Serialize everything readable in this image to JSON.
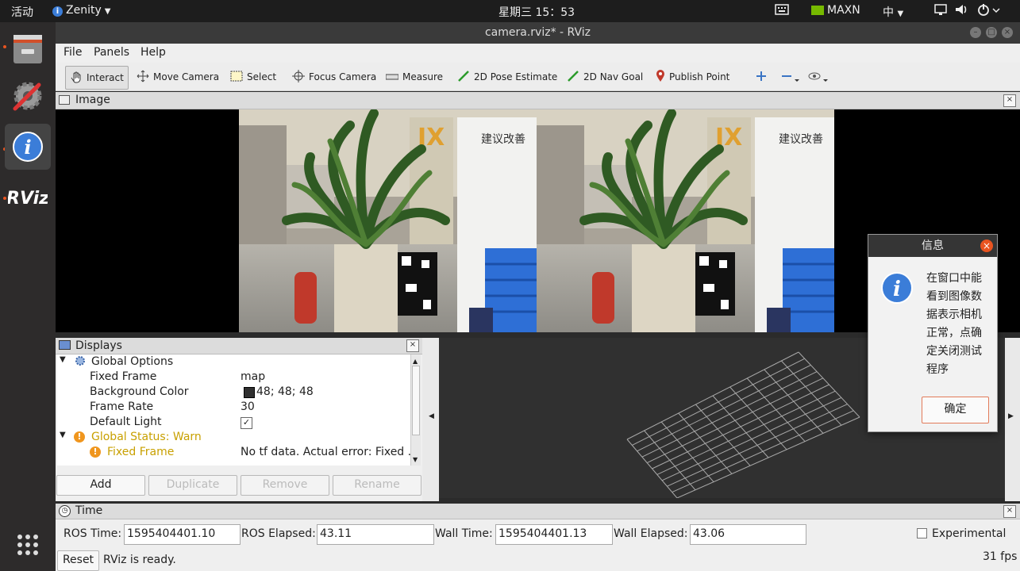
{
  "topbar": {
    "activities": "活动",
    "app_menu": "Zenity",
    "clock": "星期三 15：53",
    "power_mode": "MAXN",
    "input_method": "中"
  },
  "window": {
    "title": "camera.rviz* - RViz"
  },
  "menu": {
    "file": "File",
    "panels": "Panels",
    "help": "Help"
  },
  "toolbar": {
    "interact": "Interact",
    "move_camera": "Move Camera",
    "select": "Select",
    "focus_camera": "Focus Camera",
    "measure": "Measure",
    "pose_estimate": "2D Pose Estimate",
    "nav_goal": "2D Nav Goal",
    "publish_point": "Publish Point"
  },
  "image_panel": {
    "title": "Image",
    "sign_text": "建议改善"
  },
  "displays_panel": {
    "title": "Displays",
    "global_options": "Global Options",
    "fixed_frame_label": "Fixed Frame",
    "fixed_frame_value": "map",
    "background_color_label": "Background Color",
    "background_color_value": "48; 48; 48",
    "background_color_hex": "#303030",
    "frame_rate_label": "Frame Rate",
    "frame_rate_value": "30",
    "default_light_label": "Default Light",
    "global_status": "Global Status: Warn",
    "status_fixed_frame": "Fixed Frame",
    "status_fixed_frame_value": "No tf data.  Actual error: Fixed ...",
    "add": "Add",
    "duplicate": "Duplicate",
    "remove": "Remove",
    "rename": "Rename"
  },
  "time_panel": {
    "title": "Time",
    "ros_time_label": "ROS Time:",
    "ros_time": "1595404401.10",
    "ros_elapsed_label": "ROS Elapsed:",
    "ros_elapsed": "43.11",
    "wall_time_label": "Wall Time:",
    "wall_time": "1595404401.13",
    "wall_elapsed_label": "Wall Elapsed:",
    "wall_elapsed": "43.06",
    "experimental": "Experimental"
  },
  "status": {
    "reset": "Reset",
    "message": "RViz is ready.",
    "fps": "31 fps"
  },
  "dialog": {
    "title": "信息",
    "message_lines": [
      "在窗口中能",
      "看到图像数",
      "据表示相机",
      "正常，点确",
      "定关闭测试",
      "程序"
    ],
    "ok": "确定"
  },
  "colors": {
    "warn": "#c8a000",
    "accent": "#e95420"
  }
}
